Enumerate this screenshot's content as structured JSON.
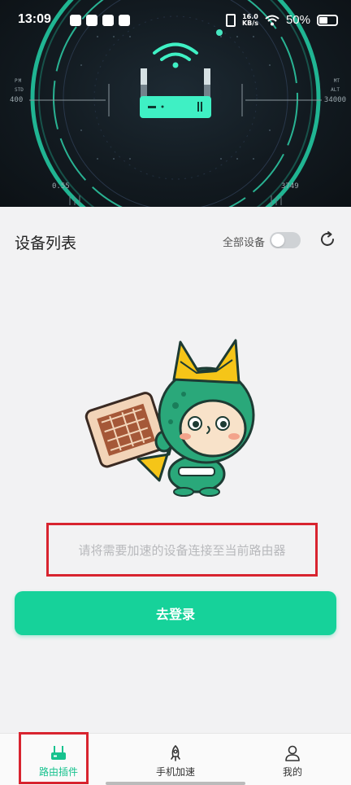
{
  "status_bar": {
    "time": "13:09",
    "network_speed_top": "16.0",
    "network_speed_unit": "KB/s",
    "battery_percent": "50%"
  },
  "hud": {
    "left_value": "400",
    "right_value": "34000",
    "left_bottom_value": "0.55",
    "right_bottom_value": "3749",
    "left_label_top": "PM",
    "left_label_bottom": "STD",
    "right_label_top": "MT",
    "right_label_bottom": "ALT"
  },
  "device_section": {
    "title": "设备列表",
    "all_devices_label": "全部设备",
    "all_devices_toggle_on": false
  },
  "hint": {
    "text": "请将需要加速的设备连接至当前路由器"
  },
  "login_button": {
    "label": "去登录"
  },
  "bottom_nav": {
    "items": [
      {
        "label": "路由插件",
        "icon": "router-icon",
        "active": true
      },
      {
        "label": "手机加速",
        "icon": "rocket-icon",
        "active": false
      },
      {
        "label": "我的",
        "icon": "person-icon",
        "active": false
      }
    ]
  },
  "colors": {
    "accent": "#16d29a",
    "highlight_box": "#d8242f",
    "hero_ring": "#3ff0c4"
  }
}
